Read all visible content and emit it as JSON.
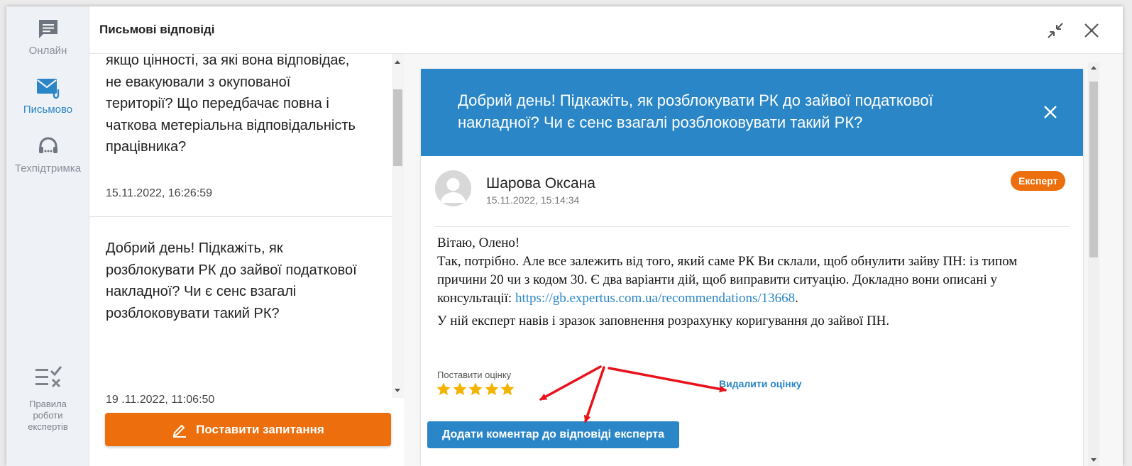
{
  "rail": {
    "online_label": "Онлайн",
    "written_label": "Письмово",
    "support_label": "Техпідтримка",
    "rules_line1": "Правила",
    "rules_line2": "роботи",
    "rules_line3": "експертів"
  },
  "header": {
    "title": "Письмові відповіді"
  },
  "questions": [
    {
      "text": "якщо цінності, за які вона відповідає, не евакуювали з окупованої території? Що передбачає повна і чаткова метеріальна відповідальність працівника?",
      "date": "15.11.2022, 16:26:59"
    },
    {
      "text": "Добрий день! Підкажіть, як розблокувати РК до зайвої податкової накладної? Чи є сенс взагалі розблоковувати такий РК?",
      "date": "19 .11.2022, 11:06:50"
    }
  ],
  "ask_button": "Поставити запитання",
  "answer_panel": {
    "question": "Добрий день! Підкажіть, як розблокувати РК до зайвої податкової накладної? Чи є сенс взагалі розблоковувати такий РК?",
    "author_name": "Шарова Оксана",
    "author_date": "15.11.2022, 15:14:34",
    "badge": "Експерт",
    "greeting": "Вітаю, Олено!",
    "body_before_link": "Так, потрібно. Але все залежить від того, який саме РК Ви склали, щоб обнулити зайву ПН: із типом причини 20 чи з кодом 30. Є два варіанти дій, щоб виправити ситуацію. Докладно вони описані у консультації: ",
    "link": "https://gb.expertus.com.ua/recommendations/13668",
    "body_after_link": ".",
    "paragraph2": "У ній експерт навів і зразок заповнення розрахунку коригування до зайвої ПН.",
    "rate_label": "Поставити оцінку",
    "rating": 5,
    "rating_max": 5,
    "delete_rating": "Видалити оцінку",
    "comment_button": "Додати коментар до відповіді експерта"
  },
  "colors": {
    "accent_blue": "#2a86c6",
    "accent_orange": "#ec6e0c",
    "star": "#f5b301",
    "annotation_red": "#e8121b"
  }
}
